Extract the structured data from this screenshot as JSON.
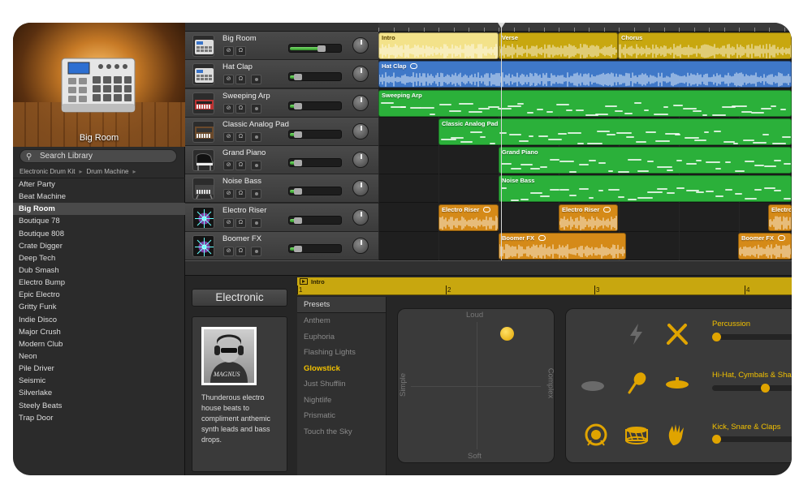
{
  "library": {
    "preview_name": "Big Room",
    "search_placeholder": "Search Library",
    "breadcrumb": [
      "Electronic Drum Kit",
      "Drum Machine"
    ],
    "items": [
      {
        "label": "After Party",
        "selected": false
      },
      {
        "label": "Beat Machine",
        "selected": false
      },
      {
        "label": "Big Room",
        "selected": true
      },
      {
        "label": "Boutique 78",
        "selected": false
      },
      {
        "label": "Boutique 808",
        "selected": false
      },
      {
        "label": "Crate Digger",
        "selected": false
      },
      {
        "label": "Deep Tech",
        "selected": false
      },
      {
        "label": "Dub Smash",
        "selected": false
      },
      {
        "label": "Electro Bump",
        "selected": false
      },
      {
        "label": "Epic Electro",
        "selected": false
      },
      {
        "label": "Gritty Funk",
        "selected": false
      },
      {
        "label": "Indie Disco",
        "selected": false
      },
      {
        "label": "Major Crush",
        "selected": false
      },
      {
        "label": "Modern Club",
        "selected": false
      },
      {
        "label": "Neon",
        "selected": false
      },
      {
        "label": "Pile Driver",
        "selected": false
      },
      {
        "label": "Seismic",
        "selected": false
      },
      {
        "label": "Silverlake",
        "selected": false
      },
      {
        "label": "Steely Beats",
        "selected": false
      },
      {
        "label": "Trap Door",
        "selected": false
      }
    ]
  },
  "tracks": [
    {
      "name": "Big Room",
      "icon": "drum-machine-icon",
      "volume": 0.72,
      "rec": false
    },
    {
      "name": "Hat Clap",
      "icon": "drum-machine-icon",
      "volume": 0.2,
      "rec": true
    },
    {
      "name": "Sweeping Arp",
      "icon": "synth-keyboard-icon",
      "volume": 0.2,
      "rec": true
    },
    {
      "name": "Classic Analog Pad",
      "icon": "analog-synth-icon",
      "volume": 0.2,
      "rec": true
    },
    {
      "name": "Grand Piano",
      "icon": "piano-icon",
      "volume": 0.2,
      "rec": true
    },
    {
      "name": "Noise Bass",
      "icon": "bass-synth-icon",
      "volume": 0.2,
      "rec": true
    },
    {
      "name": "Electro Riser",
      "icon": "sparkle-fx-icon",
      "volume": 0.2,
      "rec": true
    },
    {
      "name": "Boomer FX",
      "icon": "sparkle-fx-icon",
      "volume": 0.2,
      "rec": true
    }
  ],
  "regions": [
    [
      {
        "label": "Intro",
        "color": "yellow-light",
        "start": 0,
        "len": 148,
        "loop": false,
        "kind": "wave"
      },
      {
        "label": "Verse",
        "color": "yellow",
        "start": 148,
        "len": 147,
        "loop": false,
        "kind": "wave"
      },
      {
        "label": "Chorus",
        "color": "yellow",
        "start": 295,
        "len": 214,
        "loop": false,
        "kind": "wave"
      }
    ],
    [
      {
        "label": "Hat Clap",
        "color": "blue",
        "start": 0,
        "len": 509,
        "loop": true,
        "kind": "wave"
      }
    ],
    [
      {
        "label": "Sweeping Arp",
        "color": "green",
        "start": 0,
        "len": 509,
        "loop": false,
        "kind": "notes"
      }
    ],
    [
      {
        "label": "Classic Analog Pad",
        "color": "green",
        "start": 74,
        "len": 435,
        "loop": false,
        "kind": "notes"
      }
    ],
    [
      {
        "label": "Grand Piano",
        "color": "green",
        "start": 148,
        "len": 361,
        "loop": false,
        "kind": "notes"
      }
    ],
    [
      {
        "label": "Noise Bass",
        "color": "green",
        "start": 148,
        "len": 361,
        "loop": false,
        "kind": "notes"
      }
    ],
    [
      {
        "label": "Electro Riser",
        "color": "orange",
        "start": 74,
        "len": 74,
        "loop": true,
        "kind": "wave"
      },
      {
        "label": "Electro Riser",
        "color": "orange",
        "start": 222,
        "len": 73,
        "loop": true,
        "kind": "wave"
      },
      {
        "label": "Electro",
        "color": "orange",
        "start": 480,
        "len": 29,
        "loop": false,
        "kind": "wave"
      }
    ],
    [
      {
        "label": "Boomer FX",
        "color": "orange",
        "start": 148,
        "len": 157,
        "loop": true,
        "kind": "wave"
      },
      {
        "label": "Boomer FX",
        "color": "orange",
        "start": 443,
        "len": 66,
        "loop": true,
        "kind": "wave"
      }
    ]
  ],
  "editor": {
    "genre_title": "Electronic",
    "drummer_description": "Thunderous electro house beats to compliment anthemic synth leads and bass drops.",
    "drummer_signature": "MAGNUS",
    "region_title": "Intro",
    "bars": [
      "1",
      "2",
      "3",
      "4"
    ],
    "presets_header": "Presets",
    "presets": [
      {
        "label": "Anthem",
        "selected": false
      },
      {
        "label": "Euphoria",
        "selected": false
      },
      {
        "label": "Flashing Lights",
        "selected": false
      },
      {
        "label": "Glowstick",
        "selected": true
      },
      {
        "label": "Just Shufflin",
        "selected": false
      },
      {
        "label": "Nightlife",
        "selected": false
      },
      {
        "label": "Prismatic",
        "selected": false
      },
      {
        "label": "Touch the Sky",
        "selected": false
      }
    ],
    "xypad": {
      "loud": "Loud",
      "soft": "Soft",
      "simple": "Simple",
      "complex": "Complex"
    },
    "kit_groups": [
      {
        "label": "Percussion",
        "level": 0.0
      },
      {
        "label": "Hi-Hat, Cymbals & Shakers",
        "level": 0.6
      },
      {
        "label": "Kick, Snare & Claps",
        "level": 0.0
      }
    ]
  },
  "colors": {
    "accent": "#f2c100",
    "yellow_region": "#c8a70f",
    "blue_region": "#3f78c8",
    "green_region": "#2bb03a",
    "orange_region": "#d58a18"
  }
}
